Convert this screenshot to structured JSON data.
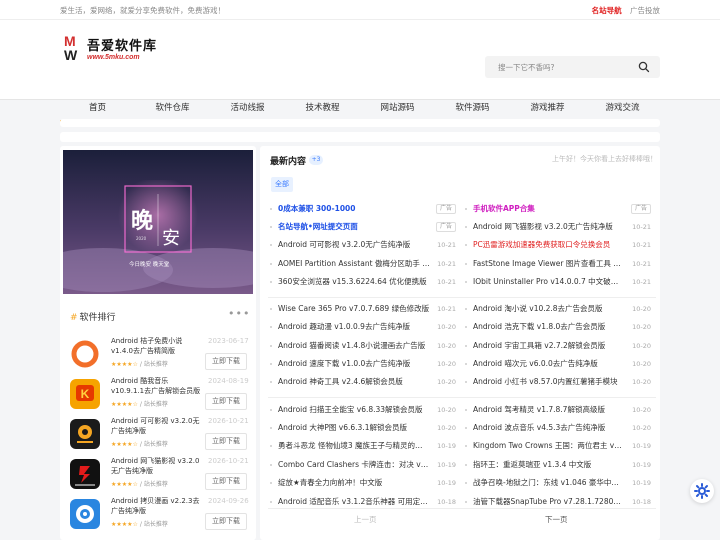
{
  "topbar": {
    "slogan": "爱生活，爱网络，就爱分享免费软件，免费游戏！",
    "links": [
      "名站导航",
      "广告投放"
    ]
  },
  "logo": {
    "cn": "吾爱软件库",
    "url": "www.5mku.com",
    "letters": [
      "M",
      "W"
    ]
  },
  "search": {
    "placeholder": "搜一下它不香吗?"
  },
  "nav": [
    "首页",
    "软件仓库",
    "活动线报",
    "技术教程",
    "网站源码",
    "软件源码",
    "游戏推荐",
    "游戏交流"
  ],
  "banner": {
    "big1": "晚",
    "big2": "安",
    "small": "2020",
    "sub": "今日晚安 晚天堂"
  },
  "rank": {
    "title": "软件排行",
    "hash": "#",
    "dots": "•••",
    "download_label": "立即下载",
    "items": [
      {
        "name": "Android 桔子免费小说 v1.4.0去广告精简版",
        "date": "2023-06-17",
        "stars": "★★★★☆",
        "rec": "/ 站长推荐",
        "color": "#f26f2a"
      },
      {
        "name": "Android 酷我音乐 v10.9.1.1去广告解锁会员版",
        "date": "2024-08-19",
        "stars": "★★★★☆",
        "rec": "/ 站长推荐",
        "color": "#f6a300"
      },
      {
        "name": "Android 可可影视 v3.2.0无广告纯净版",
        "date": "2026-10-21",
        "stars": "★★★★☆",
        "rec": "/ 站长推荐",
        "color": "#1b1b1b"
      },
      {
        "name": "Android 网飞猫影视 v3.2.0无广告纯净版",
        "date": "2026-10-21",
        "stars": "★★★★☆",
        "rec": "/ 站长推荐",
        "color": "#111111"
      },
      {
        "name": "Android 拷贝漫画 v2.2.3去广告纯净版",
        "date": "2024-09-26",
        "stars": "★★★★☆",
        "rec": "/ 站长推荐",
        "color": "#2a86e0"
      }
    ]
  },
  "latest": {
    "title": "最新内容",
    "badge": "+3",
    "greeting": "上午好！今天你看上去好棒棒哦！",
    "tab": "全部",
    "ad_label": "广告",
    "left": [
      {
        "title": "0成本兼职 300-1000",
        "style": "blue",
        "ad": true
      },
      {
        "title": "名站导航•网址提交页面",
        "style": "blue",
        "ad": true
      },
      {
        "title": "Android 可可影视 v3.2.0无广告纯净版",
        "date": "10-21"
      },
      {
        "title": "AOMEI Partition Assistant 傲梅分区助手 v10.10.1 绿色中文版",
        "date": "10-21"
      },
      {
        "title": "360安全浏览器 v15.3.6224.64 优化便携版",
        "date": "10-21"
      },
      {
        "title": "Wise Care 365 Pro v7.0.7.689 绿色修改版",
        "date": "10-21"
      },
      {
        "title": "Android 趣动漫 v1.0.0.9去广告纯净版",
        "date": "10-20"
      },
      {
        "title": "Android 猫番阅读 v1.4.8小说漫画去广告版",
        "date": "10-20"
      },
      {
        "title": "Android 速度下载 v1.0.0去广告纯净版",
        "date": "10-20"
      },
      {
        "title": "Android 神奇工具 v2.4.6解锁会员版",
        "date": "10-20"
      },
      {
        "title": "Android 扫描王全能宝 v6.8.33解锁会员版",
        "date": "10-20"
      },
      {
        "title": "Android 大神P图 v6.6.3.1解锁会员版",
        "date": "10-20"
      },
      {
        "title": "勇者斗恶龙 怪物仙境3 魔族王子与精灵的旅程",
        "date": "10-19"
      },
      {
        "title": "Combo Card Clashers 卡牌连击：对决 v1.0.2 中文版",
        "date": "10-19"
      },
      {
        "title": "绽放★青春全力向前冲！中文版",
        "date": "10-19"
      },
      {
        "title": "Android 适配音乐 v3.1.2音乐神器 可用定时关闭版",
        "date": "10-18"
      }
    ],
    "right": [
      {
        "title": "手机软件APP合集",
        "style": "magenta",
        "ad": true
      },
      {
        "title": "Android 网飞猫影视 v3.2.0无广告纯净版",
        "date": "10-21"
      },
      {
        "title": "PC迅雷游戏加速器免费获取口令兑换会员",
        "date": "10-21",
        "style": "red"
      },
      {
        "title": "FastStone Image Viewer 图片查看工具 v7.9 中文便携版",
        "date": "10-21"
      },
      {
        "title": "IObit Uninstaller Pro v14.0.0.7 中文破解版",
        "date": "10-21"
      },
      {
        "title": "Android 淘小说 v10.2.8去广告会员版",
        "date": "10-20"
      },
      {
        "title": "Android 浩克下载 v1.8.0去广告会员版",
        "date": "10-20"
      },
      {
        "title": "Android 宇宙工具箱 v2.7.2解锁会员版",
        "date": "10-20"
      },
      {
        "title": "Android 喵次元 v6.0.0去广告纯净版",
        "date": "10-20"
      },
      {
        "title": "Android 小红书 v8.57.0内置红薯猪手模块",
        "date": "10-20"
      },
      {
        "title": "Android 驾考精灵 v1.7.8.7解锁高级版",
        "date": "10-20"
      },
      {
        "title": "Android 波点音乐 v4.5.3去广告纯净版",
        "date": "10-20"
      },
      {
        "title": "Kingdom Two Crowns 王国：两位君主 v2.2.0 中文版",
        "date": "10-19"
      },
      {
        "title": "指环王：重返莫瑞亚 v1.3.4 中文版",
        "date": "10-19"
      },
      {
        "title": "战争召唤-地狱之门：东线 v1.046 豪华中文版",
        "date": "10-19"
      },
      {
        "title": "油管下载器SnapTube Pro v7.28.1.72804 解锁高级版",
        "date": "10-18"
      }
    ],
    "prev": "上一页",
    "next": "下一页"
  },
  "colors": {
    "accent": "#f5a623",
    "brand_red": "#e02020",
    "link_blue": "#1e50e6"
  }
}
